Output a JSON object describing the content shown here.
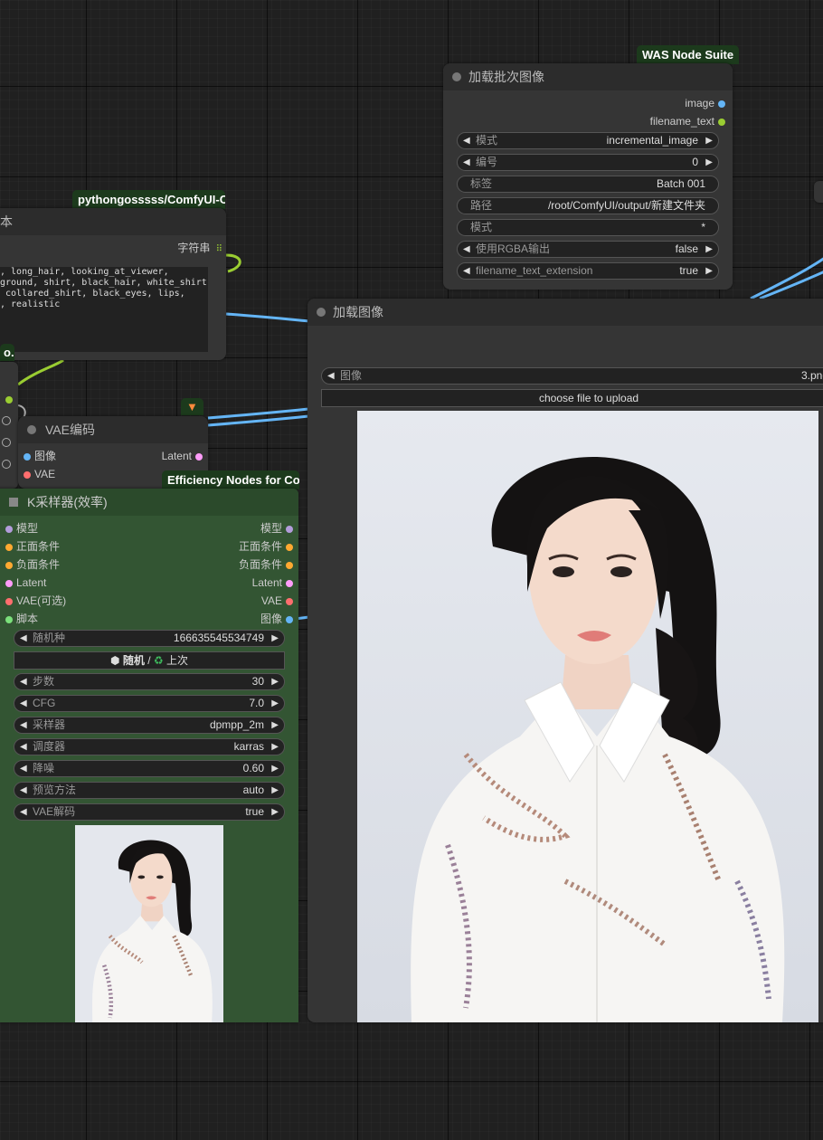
{
  "colors": {
    "wire_image": "#64b5f6",
    "wire_string": "#9acd32",
    "canvas": "#202020",
    "node_bg": "#353535",
    "ksampler_bg": "#335533"
  },
  "badges": {
    "was": "WAS Node Suite",
    "python": "pythongosssss/ComfyUI-C..",
    "efficiency": "Efficiency Nodes for Co..",
    "partial_left": "o..",
    "fox_icon": "fox-icon"
  },
  "text_node": {
    "title_partial": "本",
    "output_label": "字符串",
    "text": ", long_hair, looking_at_viewer,\nground, shirt, black_hair, white_shirt,\n collared_shirt, black_eyes, lips,\n, realistic"
  },
  "batch_node": {
    "title": "加载批次图像",
    "outputs": [
      "image",
      "filename_text"
    ],
    "widgets": [
      {
        "label": "模式",
        "value": "incremental_image",
        "arrows": true
      },
      {
        "label": "编号",
        "value": "0",
        "arrows": true
      },
      {
        "label": "标签",
        "value": "Batch 001",
        "arrows": false
      },
      {
        "label": "路径",
        "value": "/root/ComfyUI/output/新建文件夹",
        "arrows": false
      },
      {
        "label": "模式",
        "value": "*",
        "arrows": false
      },
      {
        "label": "使用RGBA输出",
        "value": "false",
        "arrows": true
      },
      {
        "label": "filename_text_extension",
        "value": "true",
        "arrows": true
      }
    ]
  },
  "load_image_node": {
    "title": "加载图像",
    "image_label": "图像",
    "image_value": "3.png",
    "upload_label": "choose file to upload"
  },
  "vae_node": {
    "title": "VAE编码",
    "inputs": [
      "图像",
      "VAE"
    ],
    "output": "Latent"
  },
  "ksampler_node": {
    "title": "K采样器(效率)",
    "rows": [
      {
        "in": "模型",
        "out": "模型"
      },
      {
        "in": "正面条件",
        "out": "正面条件"
      },
      {
        "in": "负面条件",
        "out": "负面条件"
      },
      {
        "in": "Latent",
        "out": "Latent"
      },
      {
        "in": "VAE(可选)",
        "out": "VAE"
      },
      {
        "in": "脚本",
        "out": "图像"
      }
    ],
    "seed": {
      "label": "随机种",
      "value": "166635545534749"
    },
    "seed_button": {
      "random": "随机",
      "separator": "/",
      "last": "上次"
    },
    "widgets": [
      {
        "label": "步数",
        "value": "30"
      },
      {
        "label": "CFG",
        "value": "7.0"
      },
      {
        "label": "采样器",
        "value": "dpmpp_2m"
      },
      {
        "label": "调度器",
        "value": "karras"
      },
      {
        "label": "降噪",
        "value": "0.60"
      },
      {
        "label": "预览方法",
        "value": "auto"
      },
      {
        "label": "VAE解码",
        "value": "true"
      }
    ]
  }
}
